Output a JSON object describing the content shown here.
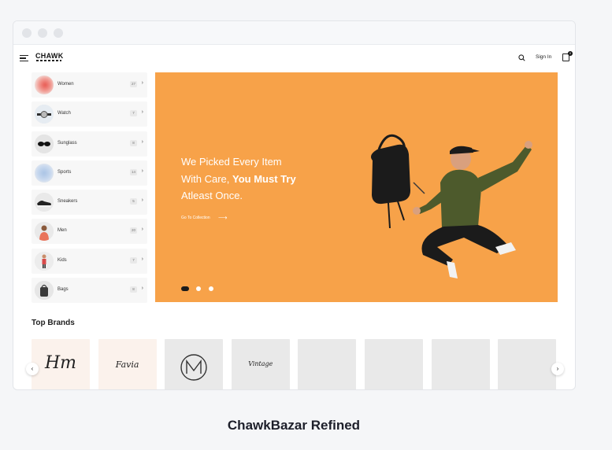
{
  "header": {
    "logo": "CHAWK",
    "signin": "Sign In",
    "cart_count": "0"
  },
  "categories": [
    {
      "name": "Women",
      "count": "27",
      "thumb": "blurred-red-thumb"
    },
    {
      "name": "Watch",
      "count": "7",
      "thumb": "watch-thumb"
    },
    {
      "name": "Sunglass",
      "count": "8",
      "thumb": "sunglass-thumb"
    },
    {
      "name": "Sports",
      "count": "14",
      "thumb": "blurred-blue-thumb"
    },
    {
      "name": "Sneakers",
      "count": "5",
      "thumb": "sneaker-thumb"
    },
    {
      "name": "Men",
      "count": "20",
      "thumb": "man-thumb"
    },
    {
      "name": "Kids",
      "count": "7",
      "thumb": "kid-thumb"
    },
    {
      "name": "Bags",
      "count": "8",
      "thumb": "bag-thumb"
    }
  ],
  "hero": {
    "line1": "We Picked Every Item",
    "line2_plain": "With Care, ",
    "line2_bold": "You Must Try",
    "line3": "Atleast Once.",
    "link": "Go To Collection",
    "color": "#f7a249"
  },
  "brands": {
    "title": "Top Brands",
    "items": [
      {
        "label": "Hm",
        "style": "script"
      },
      {
        "label": "Favia",
        "style": "script"
      },
      {
        "label": "",
        "style": "monogram"
      },
      {
        "label": "Vintage",
        "style": "script"
      },
      {
        "label": "",
        "style": "empty"
      },
      {
        "label": "",
        "style": "empty"
      },
      {
        "label": "",
        "style": "empty"
      },
      {
        "label": "",
        "style": "empty"
      }
    ]
  },
  "caption": "ChawkBazar Refined"
}
